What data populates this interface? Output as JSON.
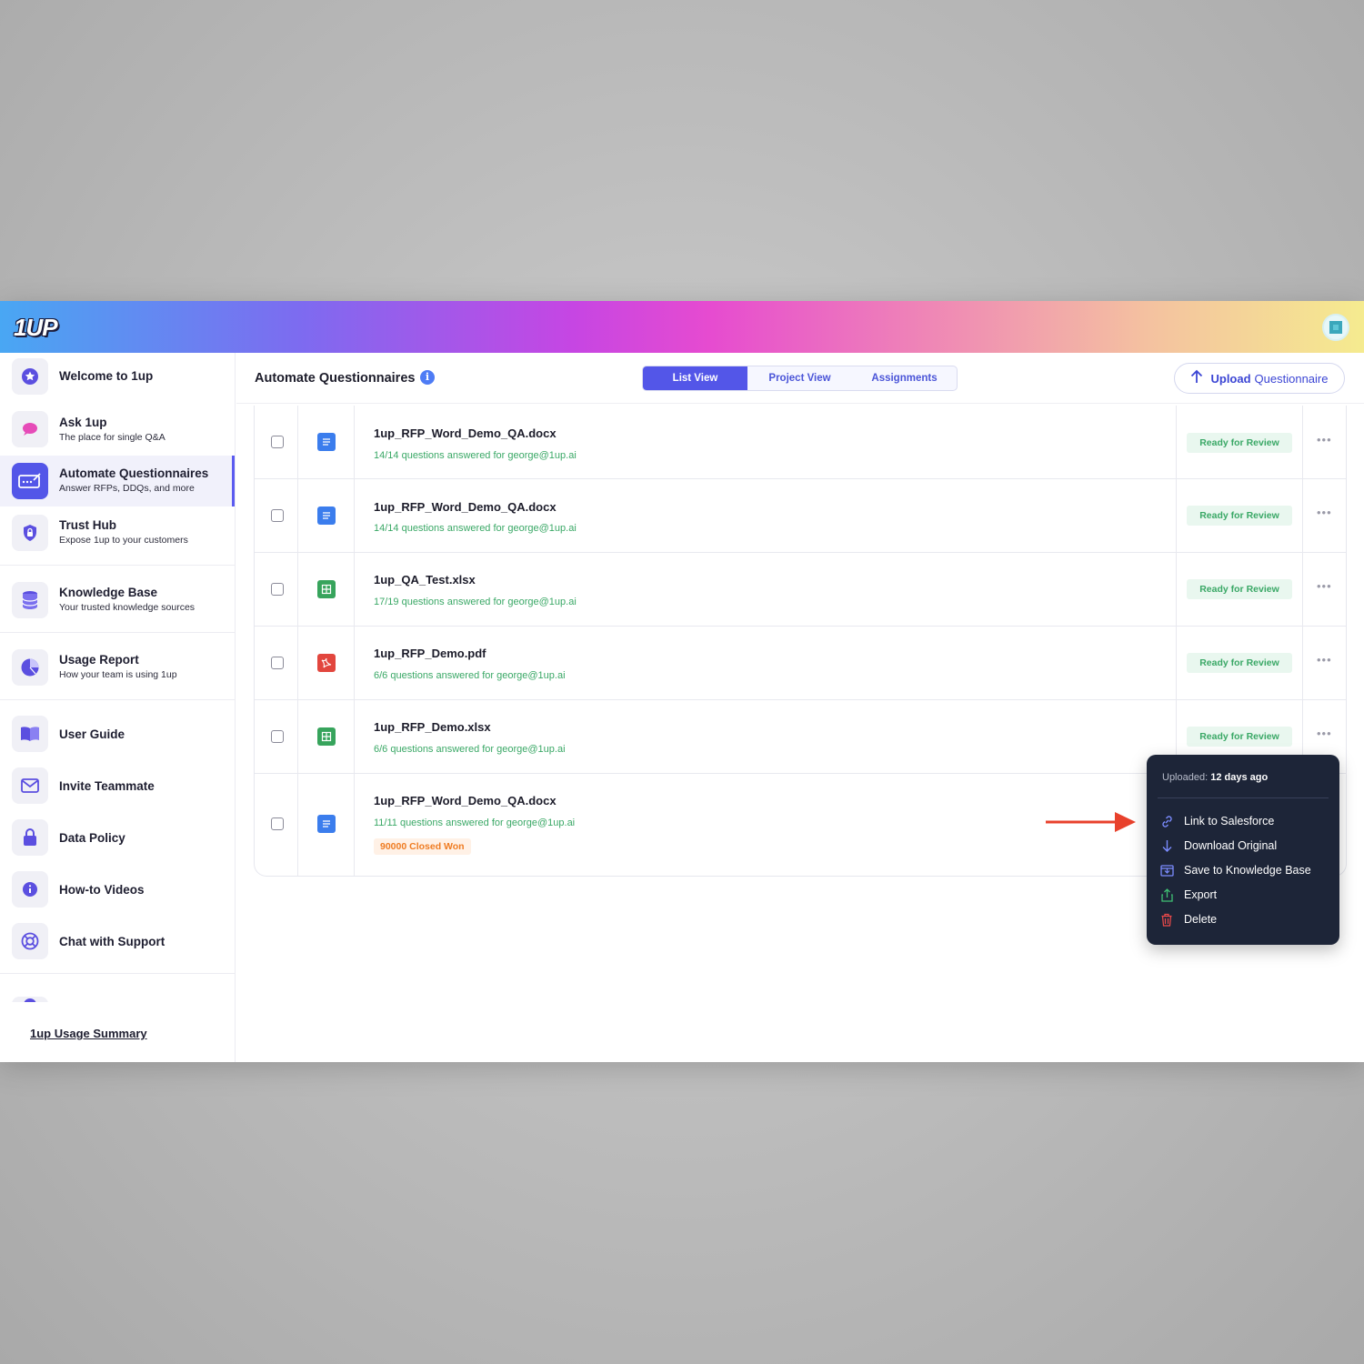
{
  "app": {
    "logo_text": "1UP"
  },
  "sidebar": {
    "items": [
      {
        "title": "Welcome to 1up",
        "subtitle": ""
      },
      {
        "title": "Ask 1up",
        "subtitle": "The place for single Q&A"
      },
      {
        "title": "Automate Questionnaires",
        "subtitle": "Answer RFPs, DDQs, and more"
      },
      {
        "title": "Trust Hub",
        "subtitle": "Expose 1up to your customers"
      },
      {
        "title": "Knowledge Base",
        "subtitle": "Your trusted knowledge sources"
      },
      {
        "title": "Usage Report",
        "subtitle": "How your team is using 1up"
      },
      {
        "title": "User Guide",
        "subtitle": ""
      },
      {
        "title": "Invite Teammate",
        "subtitle": ""
      },
      {
        "title": "Data Policy",
        "subtitle": ""
      },
      {
        "title": "How-to Videos",
        "subtitle": ""
      },
      {
        "title": "Chat with Support",
        "subtitle": ""
      }
    ],
    "usage_link": "1up Usage Summary"
  },
  "header": {
    "title": "Automate Questionnaires",
    "tabs": [
      "List View",
      "Project View",
      "Assignments"
    ],
    "active_tab": "List View",
    "upload_bold": "Upload",
    "upload_rest": "Questionnaire"
  },
  "rows": [
    {
      "name": "1up_RFP_Word_Demo_QA.docx",
      "sub": "14/14 questions answered for george@1up.ai",
      "type": "doc",
      "status": "Ready for Review"
    },
    {
      "name": "1up_RFP_Word_Demo_QA.docx",
      "sub": "14/14 questions answered for george@1up.ai",
      "type": "doc",
      "status": "Ready for Review"
    },
    {
      "name": "1up_QA_Test.xlsx",
      "sub": "17/19 questions answered for george@1up.ai",
      "type": "sheet",
      "status": "Ready for Review"
    },
    {
      "name": "1up_RFP_Demo.pdf",
      "sub": "6/6 questions answered for george@1up.ai",
      "type": "pdf",
      "status": "Ready for Review"
    },
    {
      "name": "1up_RFP_Demo.xlsx",
      "sub": "6/6 questions answered for george@1up.ai",
      "type": "sheet",
      "status": "Ready for Review"
    },
    {
      "name": "1up_RFP_Word_Demo_QA.docx",
      "sub": "11/11 questions answered for george@1up.ai",
      "type": "doc",
      "status": "",
      "deal": "90000 Closed Won"
    }
  ],
  "menu": {
    "uploaded_label": "Uploaded:",
    "uploaded_value": "12 days ago",
    "items": [
      {
        "label": "Link to Salesforce",
        "icon": "link-icon"
      },
      {
        "label": "Download Original",
        "icon": "download-icon"
      },
      {
        "label": "Save to Knowledge Base",
        "icon": "save-icon"
      },
      {
        "label": "Export",
        "icon": "export-icon"
      },
      {
        "label": "Delete",
        "icon": "trash-icon"
      }
    ]
  },
  "colors": {
    "accent": "#5356e8",
    "status_green": "#3aa866",
    "deal_orange": "#ef7c22",
    "menu_bg": "#1d2538",
    "arrow_red": "#e8412c"
  }
}
